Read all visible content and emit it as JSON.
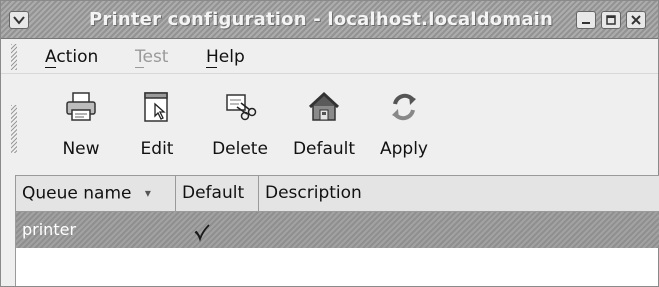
{
  "window": {
    "title": "Printer configuration - localhost.localdomain"
  },
  "menubar": {
    "items": [
      {
        "label": "Action",
        "mnemonic": "A",
        "enabled": true
      },
      {
        "label": "Test",
        "mnemonic": "T",
        "enabled": false
      },
      {
        "label": "Help",
        "mnemonic": "H",
        "enabled": true
      }
    ]
  },
  "toolbar": {
    "new_label": "New",
    "edit_label": "Edit",
    "delete_label": "Delete",
    "default_label": "Default",
    "apply_label": "Apply"
  },
  "table": {
    "columns": [
      {
        "label": "Queue name",
        "sort": "descending"
      },
      {
        "label": "Default"
      },
      {
        "label": "Description"
      }
    ],
    "rows": [
      {
        "queue": "printer",
        "is_default": true,
        "description": "",
        "selected": true
      }
    ]
  },
  "icons": {
    "window_menu": "window-menu-icon",
    "minimize": "minimize-icon",
    "maximize": "maximize-icon",
    "close": "close-icon",
    "new": "printer-icon",
    "edit": "edit-document-icon",
    "delete": "delete-scissors-icon",
    "default": "home-icon",
    "apply": "apply-refresh-icon",
    "sort": "sort-arrow-icon",
    "check": "checkmark-icon"
  },
  "colors": {
    "titlebar": "#9c9c9c",
    "selected_row": "#979797",
    "disabled_text": "#9a9a9a"
  }
}
